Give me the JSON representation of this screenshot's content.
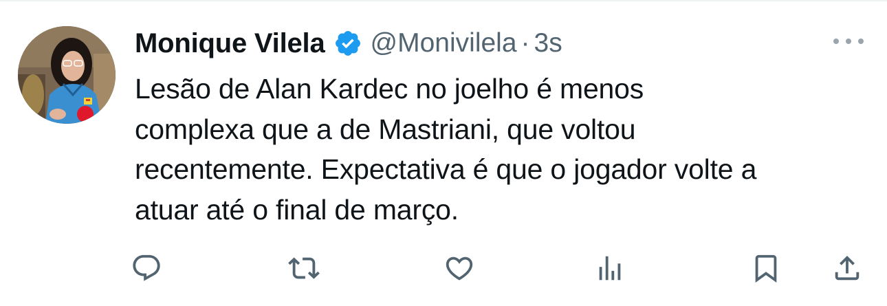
{
  "author": {
    "display_name": "Monique Vilela",
    "handle": "@Monivilela",
    "separator": "·",
    "time": "3s",
    "verified": true
  },
  "tweet": {
    "lines": [
      "Lesão de Alan Kardec no joelho é menos",
      "complexa que a de Mastriani, que voltou",
      "recentemente. Expectativa é que o jogador volte a",
      "atuar até o final de março."
    ]
  },
  "actions": [
    {
      "name": "reply",
      "icon": "reply-icon"
    },
    {
      "name": "retweet",
      "icon": "retweet-icon"
    },
    {
      "name": "like",
      "icon": "heart-icon"
    },
    {
      "name": "views",
      "icon": "analytics-icon"
    },
    {
      "name": "bookmark",
      "icon": "bookmark-icon"
    },
    {
      "name": "share",
      "icon": "share-icon"
    }
  ],
  "colors": {
    "text": "#0f1419",
    "secondary": "#536471",
    "verified": "#1d9bf0",
    "border": "#eff3f4"
  }
}
